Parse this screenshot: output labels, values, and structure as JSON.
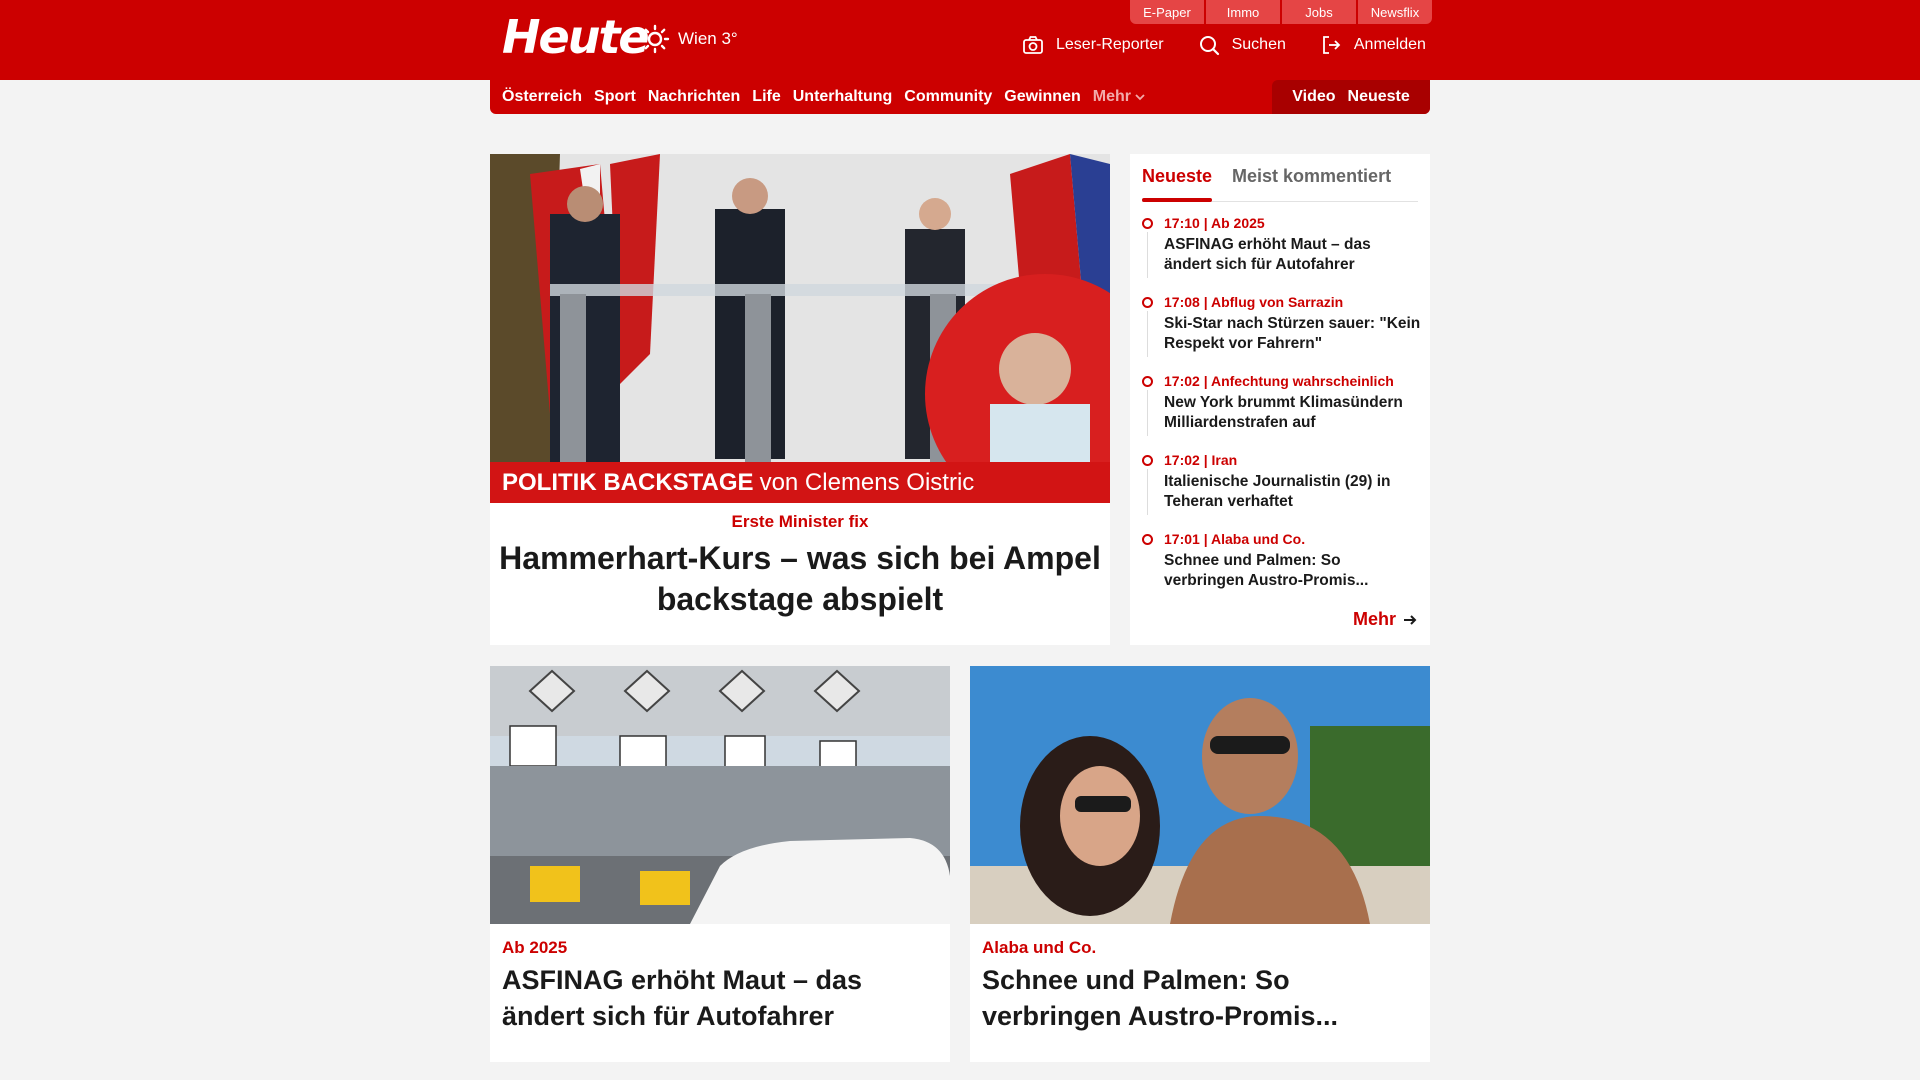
{
  "header": {
    "logo": "Heute",
    "weather": "Wien 3°",
    "weather_icon": "sun-icon",
    "service_tabs": [
      "E-Paper",
      "Immo",
      "Jobs",
      "Newsflix"
    ],
    "actions": [
      {
        "label": "Leser-Reporter",
        "icon": "camera-icon"
      },
      {
        "label": "Suchen",
        "icon": "search-icon"
      },
      {
        "label": "Anmelden",
        "icon": "login-icon"
      }
    ]
  },
  "nav": {
    "items": [
      "Österreich",
      "Sport",
      "Nachrichten",
      "Life",
      "Unterhaltung",
      "Community",
      "Gewinnen"
    ],
    "more": "Mehr",
    "right": [
      "Video",
      "Neueste"
    ]
  },
  "hero": {
    "banner_bold": "POLITIK BACKSTAGE",
    "banner_rest": "von Clemens Oistric",
    "kicker": "Erste Minister fix",
    "title": "Hammerhart-Kurs – was sich bei Ampel backstage abspielt"
  },
  "sidebar": {
    "tabs": [
      "Neueste",
      "Meist kommentiert"
    ],
    "items": [
      {
        "meta": "17:10 | Ab 2025",
        "title": "ASFINAG erhöht Maut – das ändert sich für Autofahrer"
      },
      {
        "meta": "17:08 | Abflug von Sarrazin",
        "title": "Ski-Star nach Stürzen sauer: \"Kein Respekt vor Fahrern\""
      },
      {
        "meta": "17:02 | Anfechtung wahrscheinlich",
        "title": "New York brummt Klimasündern Milliardenstrafen auf"
      },
      {
        "meta": "17:02 | Iran",
        "title": "Italienische Journalistin (29) in Teheran verhaftet"
      },
      {
        "meta": "17:01 | Alaba und Co.",
        "title": "Schnee und Palmen: So verbringen Austro-Promis..."
      }
    ],
    "more": "Mehr"
  },
  "cards": [
    {
      "kicker": "Ab 2025",
      "title": "ASFINAG erhöht Maut – das ändert sich für Autofahrer"
    },
    {
      "kicker": "Alaba und Co.",
      "title": "Schnee und Palmen: So verbringen Austro-Promis..."
    }
  ],
  "colors": {
    "brand": "#cc0000",
    "background": "#f3f3f3"
  }
}
